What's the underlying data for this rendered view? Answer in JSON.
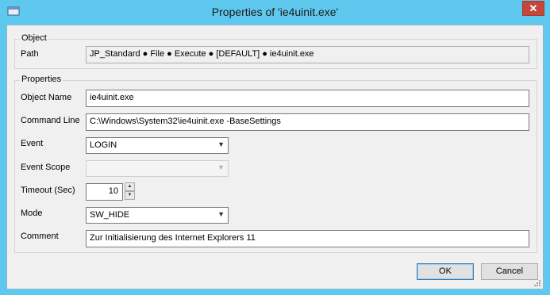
{
  "window": {
    "title": "Properties of 'ie4uinit.exe'",
    "close_glyph": "✕"
  },
  "object_group": {
    "legend": "Object",
    "path_label": "Path",
    "path_value": "JP_Standard ● File ● Execute ● [DEFAULT] ● ie4uinit.exe"
  },
  "properties_group": {
    "legend": "Properties",
    "object_name_label": "Object Name",
    "object_name_value": "ie4uinit.exe",
    "command_line_label": "Command Line",
    "command_line_value": "C:\\Windows\\System32\\ie4uinit.exe -BaseSettings",
    "event_label": "Event",
    "event_value": "LOGIN",
    "event_scope_label": "Event Scope",
    "event_scope_value": "",
    "timeout_label": "Timeout (Sec)",
    "timeout_value": "10",
    "mode_label": "Mode",
    "mode_value": "SW_HIDE",
    "comment_label": "Comment",
    "comment_value": "Zur Initialisierung des Internet Explorers 11"
  },
  "buttons": {
    "ok": "OK",
    "cancel": "Cancel"
  },
  "icons": {
    "app": "window-icon",
    "dropdown": "chevron-down-icon",
    "spin_up": "spin-up-icon",
    "spin_down": "spin-down-icon"
  }
}
